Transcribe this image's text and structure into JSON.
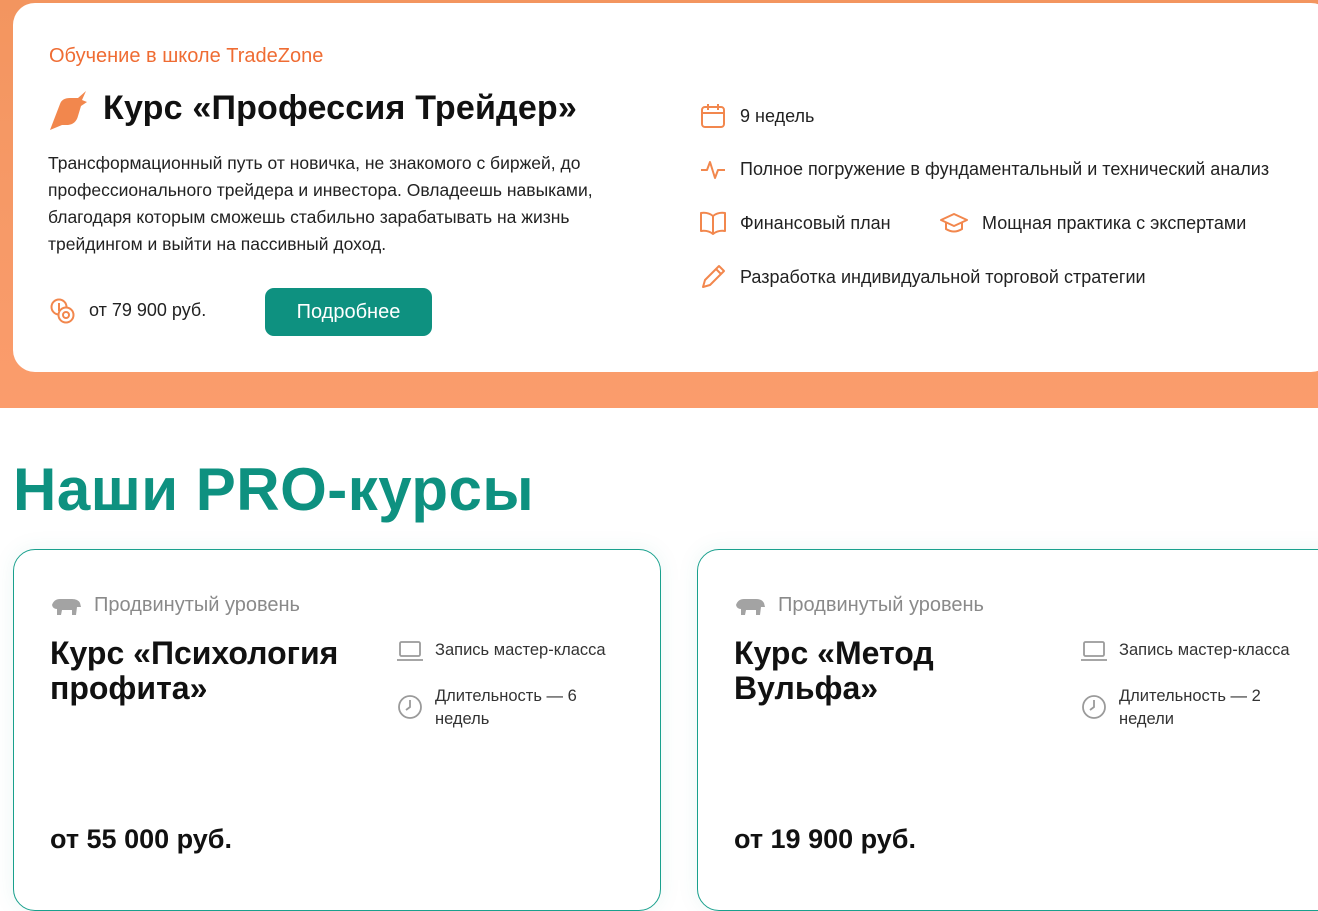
{
  "hero": {
    "eyebrow": "Обучение в школе TradeZone",
    "title": "Курс «Профессия Трейдер»",
    "description": "Трансформационный путь от новичка, не знакомого с биржей, до профессионального трейдера и инвестора. Овладеешь навыками, благодаря которым сможешь стабильно зарабатывать на жизнь трейдингом и выйти на пассивный доход.",
    "price": "от 79 900 руб.",
    "button_label": "Подробнее",
    "features": [
      {
        "icon": "calendar-icon",
        "text": "9 недель"
      },
      {
        "icon": "pulse-icon",
        "text": "Полное погружение в фундаментальный и технический анализ"
      },
      {
        "icon": "book-icon",
        "text": "Финансовый план"
      },
      {
        "icon": "graduation-cap-icon",
        "text": "Мощная практика с экспертами"
      },
      {
        "icon": "pencil-icon",
        "text": "Разработка индивидуальной торговой стратегии"
      }
    ]
  },
  "section": {
    "title": "Наши PRO-курсы"
  },
  "courses": [
    {
      "level": "Продвинутый уровень",
      "title": "Курс «Психология профита»",
      "format": "Запись мастер-класса",
      "duration": "Длительность — 6 недель",
      "price": "от 55 000 руб."
    },
    {
      "level": "Продвинутый уровень",
      "title": "Курс «Метод Вульфа»",
      "format": "Запись мастер-класса",
      "duration": "Длительность — 2 недели",
      "price": "от 19 900 руб."
    }
  ],
  "colors": {
    "accent": "#0e9180",
    "orange": "#ef6c33"
  }
}
